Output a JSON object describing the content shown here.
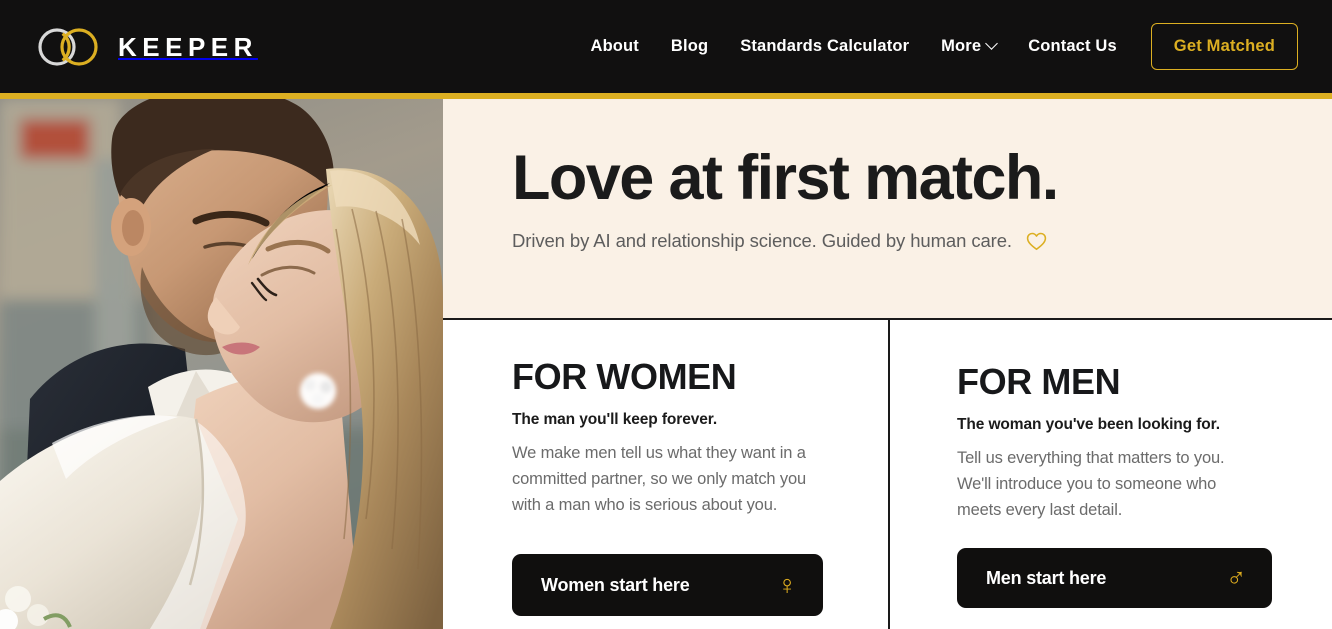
{
  "header": {
    "brand_name": "KEEPER",
    "logo_icon": "two-interlocking-rings-icon",
    "nav": [
      {
        "label": "About",
        "icon": null
      },
      {
        "label": "Blog",
        "icon": null
      },
      {
        "label": "Standards Calculator",
        "icon": null
      },
      {
        "label": "More",
        "icon": "chevron-down-icon"
      },
      {
        "label": "Contact Us",
        "icon": null
      }
    ],
    "cta_label": "Get Matched",
    "background_color": "#111010",
    "accent_color": "#dcaf22"
  },
  "hero": {
    "title": "Love at first match.",
    "subtitle": "Driven by AI and relationship science. Guided by human care.",
    "subtitle_icon": "heart-outline-icon",
    "panel_background": "#faf1e6",
    "photo_alt": "Couple embracing, bride in white blazer with groom"
  },
  "sections": {
    "women": {
      "title": "FOR WOMEN",
      "lede": "The man you'll keep forever.",
      "body": "We make men tell us what they want in a committed partner, so we only match you with a man who is serious about you.",
      "button_label": "Women start here",
      "button_icon": "venus-symbol-icon",
      "button_glyph": "♀"
    },
    "men": {
      "title": "FOR MEN",
      "lede": "The woman you've been looking for.",
      "body": "Tell us everything that matters to you. We'll introduce you to someone who meets every last detail.",
      "button_label": "Men start here",
      "button_icon": "mars-symbol-icon",
      "button_glyph": "♂"
    }
  }
}
